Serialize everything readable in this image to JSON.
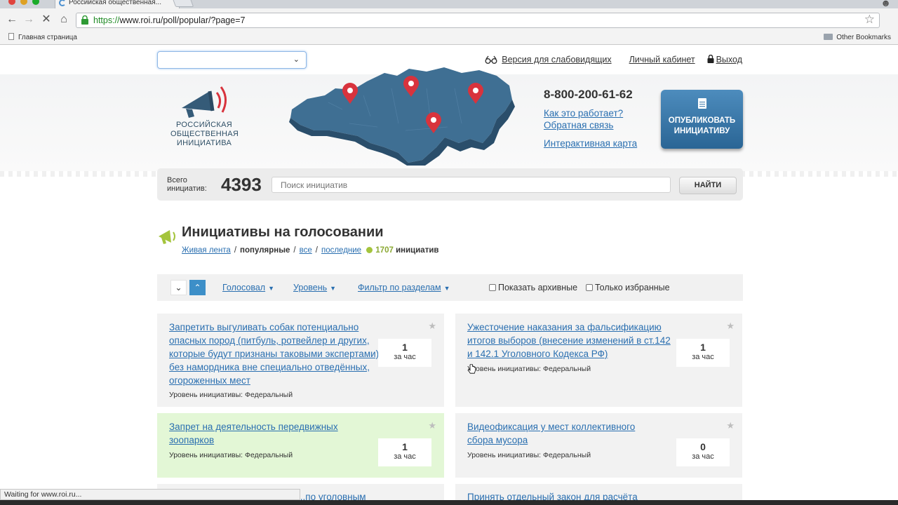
{
  "browser": {
    "tab_title": "Российская общественная...",
    "url_scheme": "https://",
    "url_rest": "www.roi.ru/poll/popular/?page=7",
    "bookmark_left": "Главная страница",
    "bookmark_right": "Other Bookmarks",
    "status": "Waiting for www.roi.ru..."
  },
  "top": {
    "region_value": "",
    "links": {
      "accessibility": "Версия для слабовидящих",
      "cabinet": "Личный кабинет",
      "logout": "Выход"
    }
  },
  "header": {
    "logo_text_1": "РОССИЙСКАЯ",
    "logo_text_2": "ОБЩЕСТВЕННАЯ",
    "logo_text_3": "ИНИЦИАТИВА",
    "phone": "8-800-200-61-62",
    "link_how": "Как это работает?",
    "link_feedback": "Обратная связь",
    "link_map": "Интерактивная карта",
    "publish_1": "ОПУБЛИКОВАТЬ",
    "publish_2": "ИНИЦИАТИВУ"
  },
  "search": {
    "total_label_1": "Всего",
    "total_label_2": "инициатив:",
    "total": "4393",
    "placeholder": "Поиск инициатив",
    "button": "НАЙТИ"
  },
  "section": {
    "title": "Инициативы на голосовании",
    "crumb_live": "Живая лента",
    "crumb_popular": "популярные",
    "crumb_all": "все",
    "crumb_recent": "последние",
    "count": "1707",
    "count_unit": "инициатив"
  },
  "sortbar": {
    "down": "⌄",
    "up": "⌃",
    "dd_votes": "Голосовал",
    "dd_level": "Уровень",
    "dd_filter": "Фильтр по разделам",
    "chk_archive": "Показать архивные",
    "chk_fav": "Только избранные"
  },
  "cards": [
    {
      "title": "Запретить выгуливать собак потенциально опасных пород (питбуль, ротвейлер и других, которые будут признаны таковыми экспертами) без намордника вне специально отведённых, огороженных мест",
      "level": "Уровень инициативы: Федеральный",
      "votes": "1",
      "unit": "за час"
    },
    {
      "title": "Ужесточение наказания за фальсификацию итогов выборов (внесение изменений в ст.142 и 142.1 Уголовного Кодекса РФ)",
      "level": "Уровень инициативы: Федеральный",
      "votes": "1",
      "unit": "за час"
    },
    {
      "title": "Запрет на деятельность передвижных зоопарков",
      "level": "Уровень инициативы: Федеральный",
      "votes": "1",
      "unit": "за час"
    },
    {
      "title": "Видеофиксация у мест коллективного сбора мусора",
      "level": "Уровень инициативы: Федеральный",
      "votes": "0",
      "unit": "за час"
    },
    {
      "title": "...по уголовным",
      "level": "",
      "votes": "",
      "unit": ""
    },
    {
      "title": "Принять отдельный закон для расчёта",
      "level": "",
      "votes": "",
      "unit": ""
    }
  ]
}
